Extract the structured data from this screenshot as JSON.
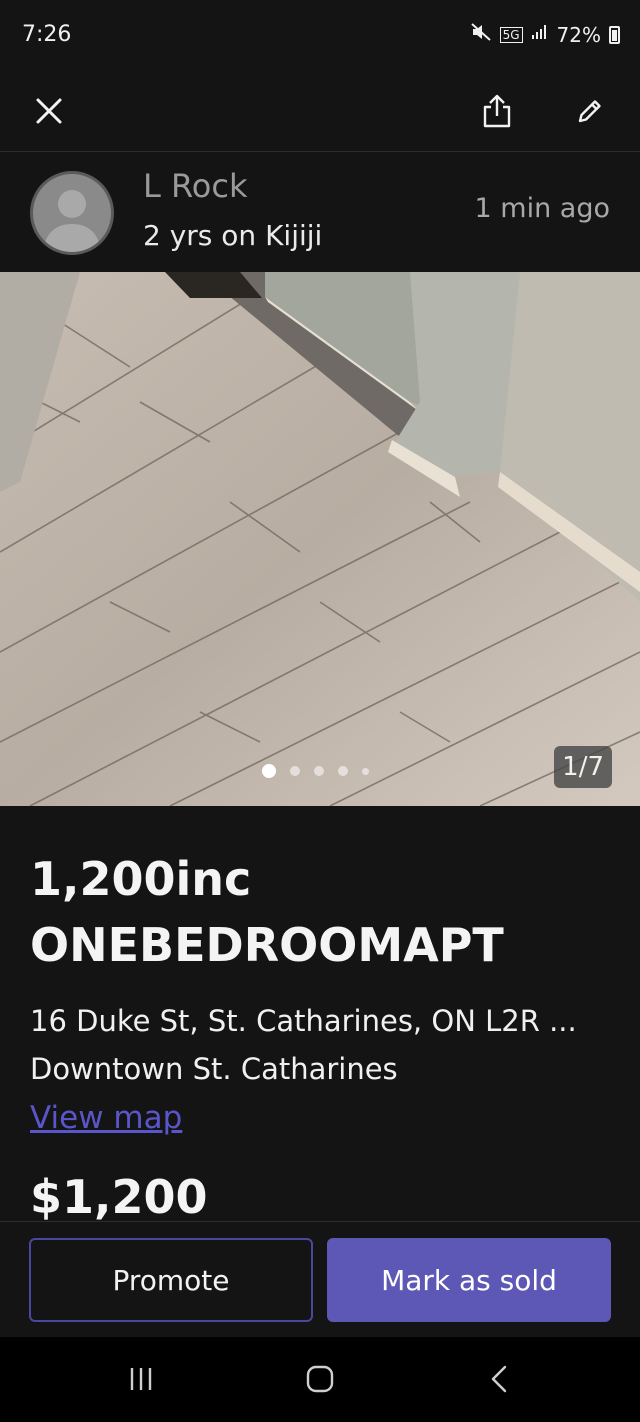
{
  "status_bar": {
    "time": "7:26",
    "network": "5G",
    "battery_percent": "72%",
    "icons": [
      "mute-icon",
      "network-5g-icon",
      "signal-icon",
      "battery-icon"
    ]
  },
  "top_bar": {
    "icons": [
      "close-icon",
      "share-icon",
      "edit-icon"
    ]
  },
  "seller": {
    "name": "L Rock",
    "tenure": "2 yrs on Kijiji",
    "posted": "1 min ago"
  },
  "gallery": {
    "counter": "1/7",
    "dots_visible": 5,
    "active_dot": 1
  },
  "listing": {
    "title": "1,200inc ONEBEDROOMAPT",
    "address": "16 Duke St, St. Catharines, ON L2R ...",
    "neighbourhood": "Downtown St. Catharines",
    "map_link": "View map",
    "price": "$1,200"
  },
  "actions": {
    "promote": "Promote",
    "mark_sold": "Mark as sold"
  },
  "nav": {
    "icons": [
      "recent-apps-icon",
      "home-icon",
      "back-icon"
    ]
  },
  "colors": {
    "background": "#141414",
    "accent": "#5d58b5",
    "link": "#5a55c8"
  }
}
